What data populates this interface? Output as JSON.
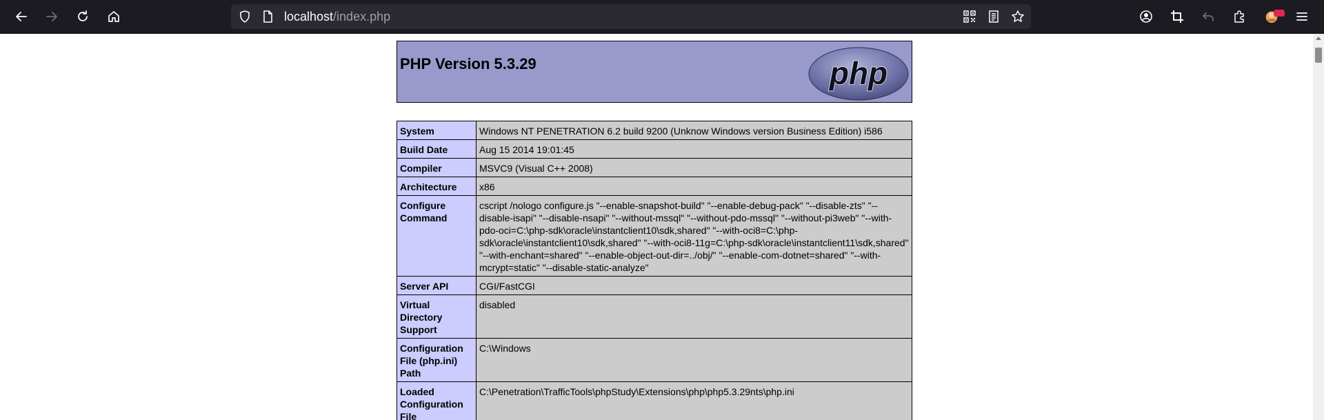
{
  "browser": {
    "url_host": "localhost",
    "url_path": "/index.php",
    "icons": {
      "nav": [
        "back-arrow-icon",
        "forward-arrow-icon",
        "reload-icon",
        "home-icon"
      ],
      "urlbar": [
        "shield-icon",
        "page-icon",
        "qr-code-icon",
        "reader-view-icon",
        "star-icon"
      ],
      "right": [
        "account-icon",
        "screenshot-crop-icon",
        "undo-icon",
        "extensions-icon",
        "extension-avatar-icon",
        "menu-icon"
      ]
    }
  },
  "php": {
    "title": "PHP Version 5.3.29",
    "logo_text": "php",
    "colors": {
      "header": "#9999cc",
      "label": "#ccccff",
      "value": "#cccccc"
    },
    "rows": [
      {
        "label": "System",
        "value": "Windows NT PENETRATION 6.2 build 9200 (Unknow Windows version Business Edition) i586"
      },
      {
        "label": "Build Date",
        "value": "Aug 15 2014 19:01:45"
      },
      {
        "label": "Compiler",
        "value": "MSVC9 (Visual C++ 2008)"
      },
      {
        "label": "Architecture",
        "value": "x86"
      },
      {
        "label": "Configure Command",
        "value": "cscript /nologo configure.js \"--enable-snapshot-build\" \"--enable-debug-pack\" \"--disable-zts\" \"--disable-isapi\" \"--disable-nsapi\" \"--without-mssql\" \"--without-pdo-mssql\" \"--without-pi3web\" \"--with-pdo-oci=C:\\php-sdk\\oracle\\instantclient10\\sdk,shared\" \"--with-oci8=C:\\php-sdk\\oracle\\instantclient10\\sdk,shared\" \"--with-oci8-11g=C:\\php-sdk\\oracle\\instantclient11\\sdk,shared\" \"--with-enchant=shared\" \"--enable-object-out-dir=../obj/\" \"--enable-com-dotnet=shared\" \"--with-mcrypt=static\" \"--disable-static-analyze\""
      },
      {
        "label": "Server API",
        "value": "CGI/FastCGI"
      },
      {
        "label": "Virtual Directory Support",
        "value": "disabled"
      },
      {
        "label": "Configuration File (php.ini) Path",
        "value": "C:\\Windows"
      },
      {
        "label": "Loaded Configuration File",
        "value": "C:\\Penetration\\TrafficTools\\phpStudy\\Extensions\\php\\php5.3.29nts\\php.ini"
      }
    ]
  }
}
